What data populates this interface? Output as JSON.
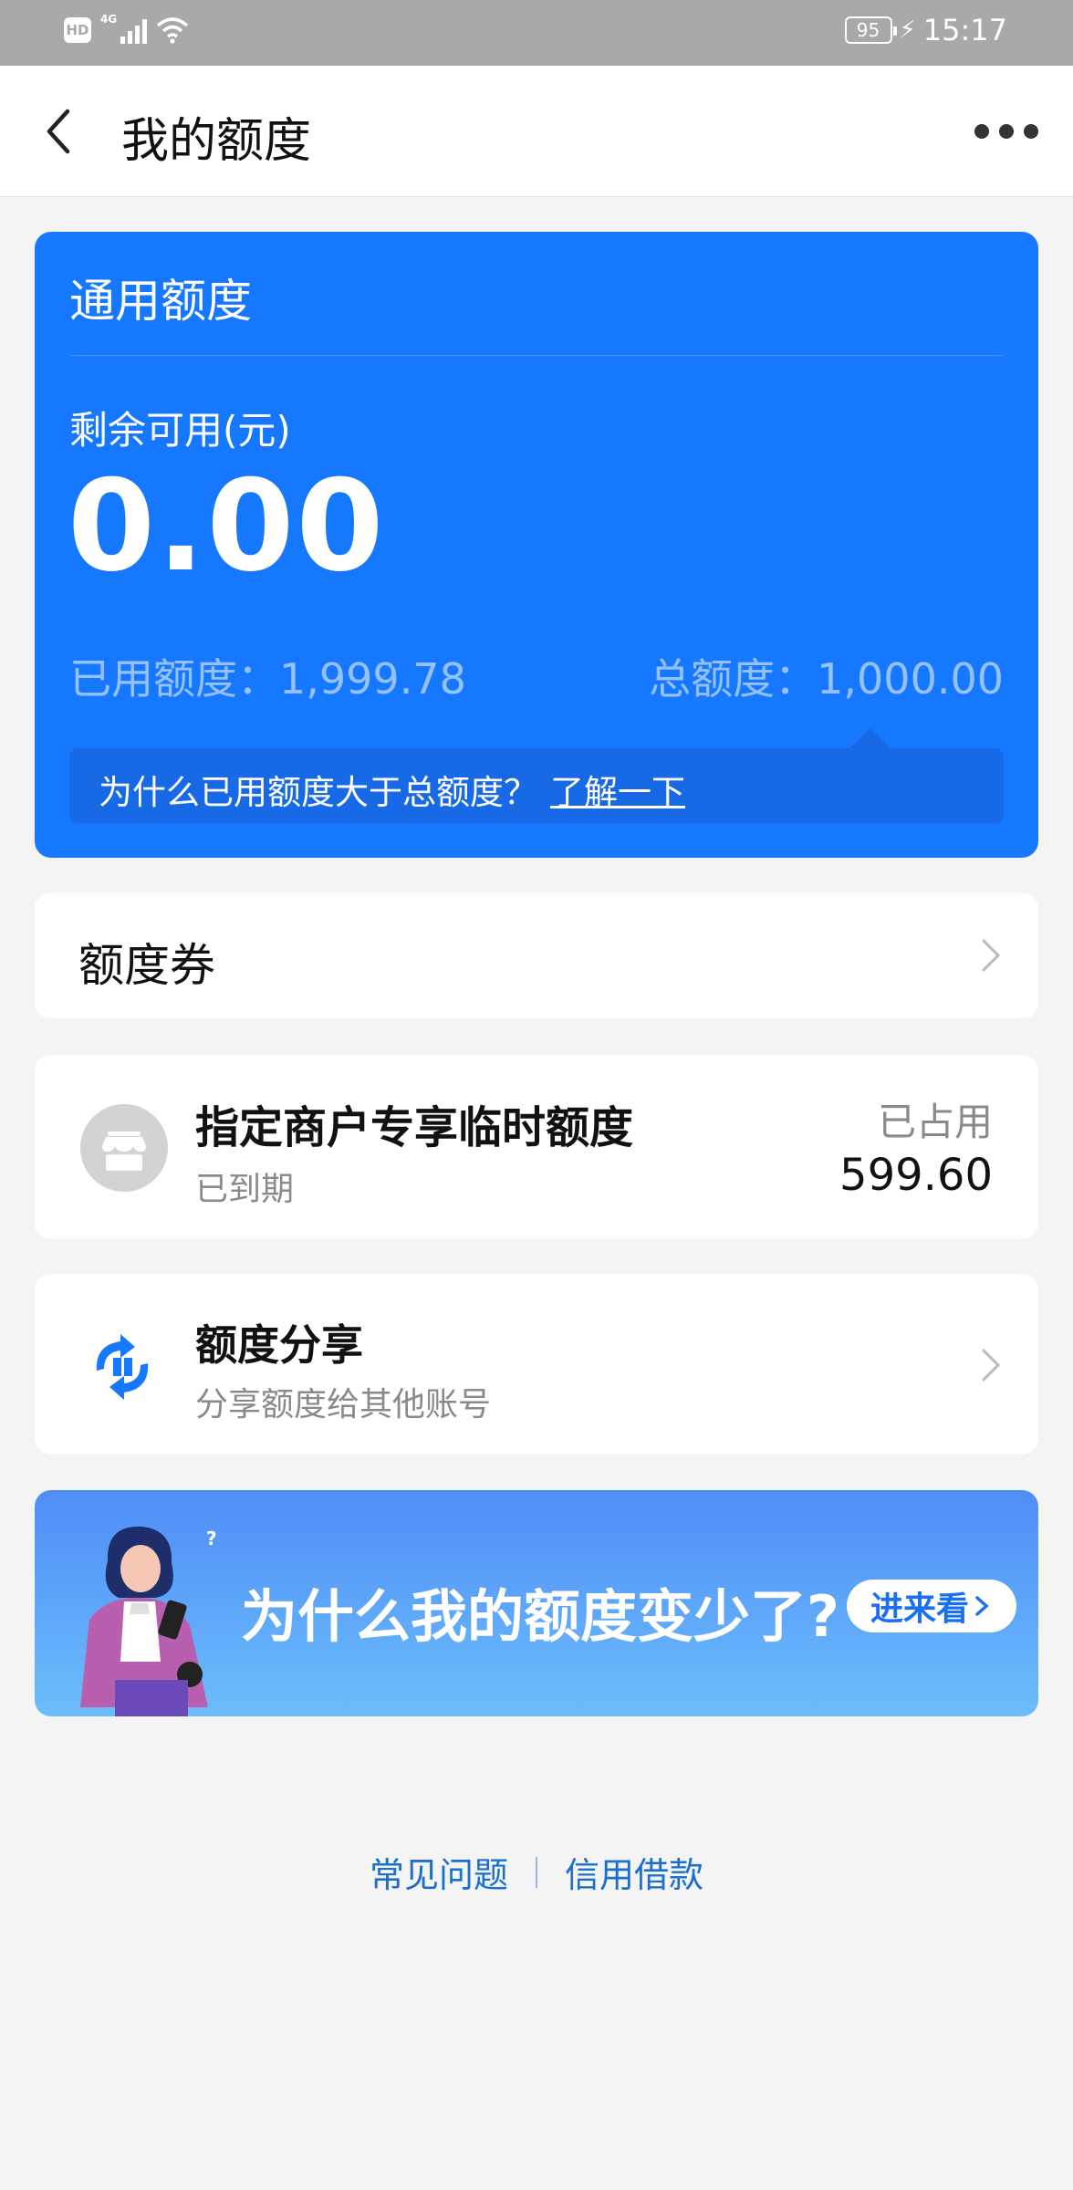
{
  "status_bar": {
    "hd": "HD",
    "network": "4G",
    "battery": "95",
    "time": "15:17"
  },
  "nav": {
    "title": "我的额度"
  },
  "credit_card": {
    "title": "通用额度",
    "available_label": "剩余可用(元)",
    "available_amount": "0.00",
    "used_label": "已用额度：",
    "used_amount": "1,999.78",
    "total_label": "总额度：",
    "total_amount": "1,000.00",
    "why_text": "为什么已用额度大于总额度？",
    "why_link": "了解一下"
  },
  "coupon": {
    "label": "额度券"
  },
  "merchant_quota": {
    "title": "指定商户专享临时额度",
    "status": "已到期",
    "occupied_label": "已占用",
    "occupied_amount": "599.60",
    "icon": "shop-icon"
  },
  "share": {
    "title": "额度分享",
    "subtitle": "分享额度给其他账号",
    "icon": "share-exchange-icon"
  },
  "banner": {
    "text": "为什么我的额度变少了?",
    "button": "进来看"
  },
  "footer": {
    "faq": "常见问题",
    "credit_loan": "信用借款"
  },
  "colors": {
    "primary_blue": "#1677ff",
    "link_blue": "#1a6fcf",
    "background": "#f4f4f4"
  }
}
